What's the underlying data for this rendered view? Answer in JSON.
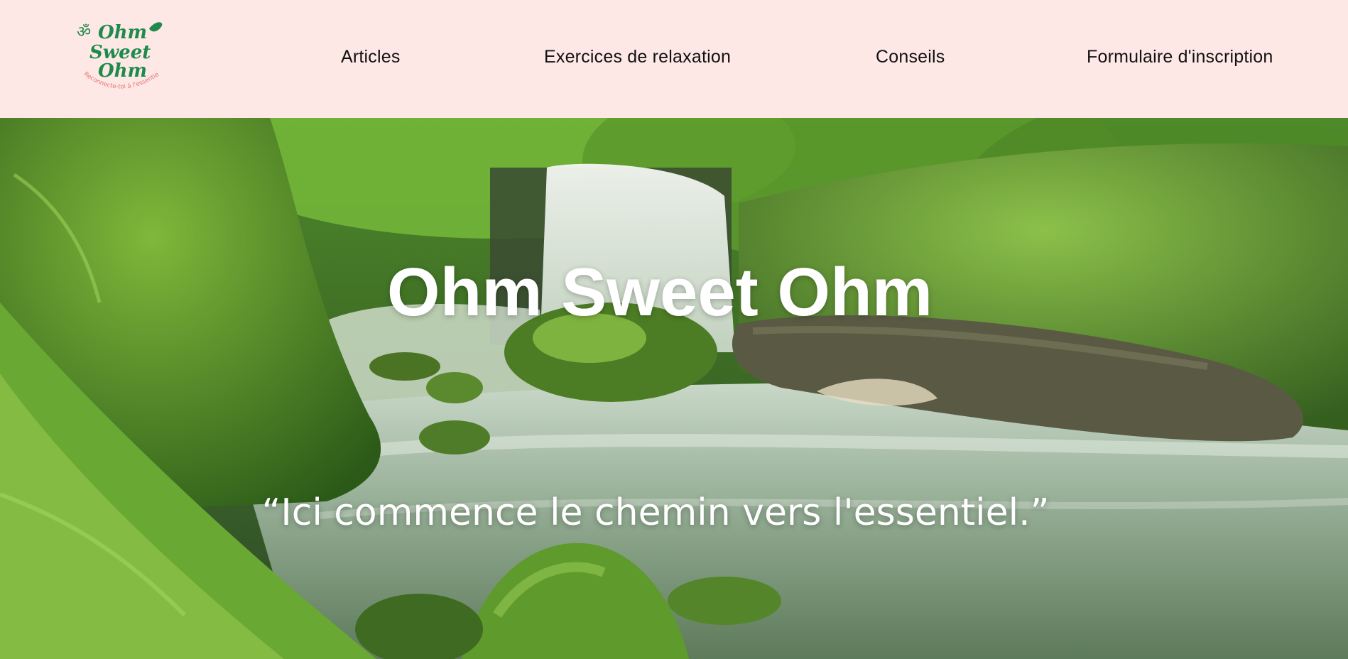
{
  "brand": {
    "name_line1": "Ohm",
    "name_line2": "Sweet",
    "name_line3": "Ohm",
    "tagline": "Reconnecte-toi à l'essentiel",
    "colors": {
      "green": "#1f8a4c",
      "pink": "#e8736b",
      "header_bg": "#fde8e6"
    }
  },
  "nav": {
    "items": [
      {
        "label": "Articles"
      },
      {
        "label": "Exercices de relaxation"
      },
      {
        "label": "Conseils"
      },
      {
        "label": "Formulaire d'inscription"
      }
    ]
  },
  "hero": {
    "title": "Ohm Sweet Ohm",
    "quote": "“Ici commence le chemin vers l'essentiel.”",
    "image_subject": "forest-waterfall-photo"
  }
}
